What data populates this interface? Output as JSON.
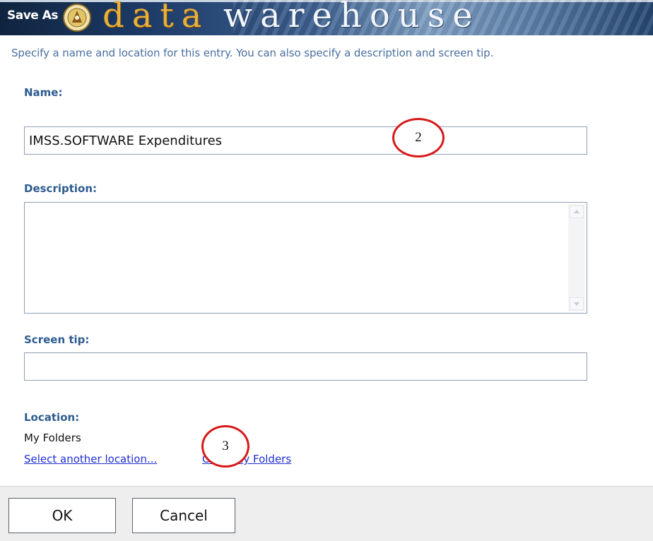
{
  "banner": {
    "save_as_label": "Save As",
    "logo_word_1": "data",
    "logo_word_2": "warehouse",
    "seal_icon": "university-seal-icon",
    "colors": {
      "data_text": "#e8b03a",
      "warehouse_text": "#f3f6fb",
      "banner_dark": "#1c3a66"
    }
  },
  "intro_text": "Specify a name and location for this entry. You can also specify a description and screen tip.",
  "fields": {
    "name_label": "Name:",
    "name_value": "IMSS.SOFTWARE Expenditures",
    "description_label": "Description:",
    "description_value": "",
    "screen_tip_label": "Screen tip:",
    "screen_tip_value": ""
  },
  "location": {
    "label": "Location:",
    "value": "My Folders",
    "select_link": "Select another location...",
    "goto_link": "Go to My Folders"
  },
  "annotations": {
    "callout_2": "2",
    "callout_3": "3",
    "circle_color": "#d71818"
  },
  "buttons": {
    "ok": "OK",
    "cancel": "Cancel"
  },
  "colors": {
    "label_blue": "#2d5b8f",
    "intro_blue": "#4a6fa0",
    "link_blue": "#1f2fd1",
    "footer_bg": "#eeeeee"
  }
}
